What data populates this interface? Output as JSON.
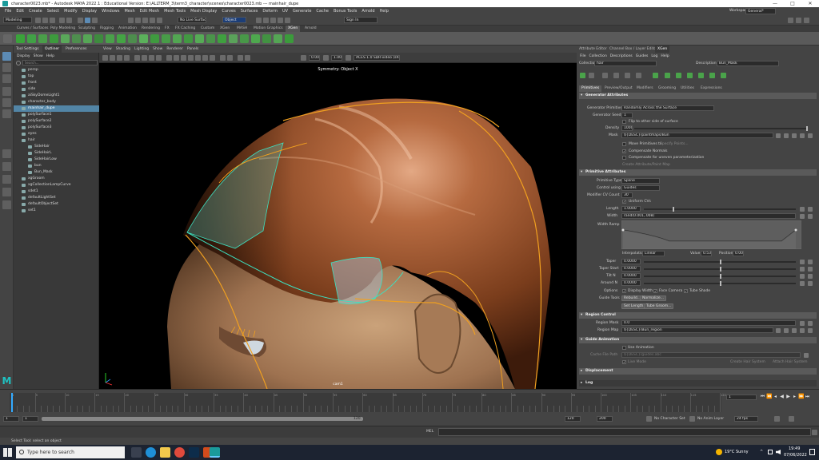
{
  "titlebar": {
    "title": "character0023.mb* - Autodesk MAYA 2022.1 : Educational Version: E:\\ALLTERM_3\\term3_character\\scenes\\character0023.mb  ---  mainhair_dupe",
    "controls": [
      "—",
      "□",
      "✕"
    ]
  },
  "menubar": {
    "items": [
      "File",
      "Edit",
      "Create",
      "Select",
      "Modify",
      "Display",
      "Windows",
      "Mesh",
      "Edit Mesh",
      "Mesh Tools",
      "Mesh Display",
      "Curves",
      "Surfaces",
      "Deform",
      "UV",
      "Generate",
      "Cache",
      "Bonus Tools",
      "Arnold",
      "Help"
    ],
    "workspace_label": "Workspace:",
    "workspace_value": "General*"
  },
  "statusline": {
    "mode": "Modeling",
    "object_field": "Object",
    "live_surface": "No Live Surface",
    "sign_in": "Sign In"
  },
  "shelf_tabs": [
    "Curves / Surfaces",
    "Poly Modeling",
    "Sculpting",
    "Rigging",
    "Animation",
    "Rendering",
    "FX",
    "FX Caching",
    "Custom",
    "XGen",
    "MASH",
    "Motion Graphics",
    "XGen",
    "Arnold"
  ],
  "shelf_active": 12,
  "outliner": {
    "tabs": [
      "Tool Settings",
      "Outliner",
      "Preferences"
    ],
    "menu": [
      "Display",
      "Show",
      "Help"
    ],
    "search_placeholder": "Search...",
    "rows": [
      {
        "label": "persp",
        "indent": 0,
        "sel": false
      },
      {
        "label": "top",
        "indent": 0,
        "sel": false
      },
      {
        "label": "front",
        "indent": 0,
        "sel": false
      },
      {
        "label": "side",
        "indent": 0,
        "sel": false
      },
      {
        "label": "aiSkyDomeLight1",
        "indent": 0,
        "sel": false
      },
      {
        "label": "character_body",
        "indent": 0,
        "sel": false
      },
      {
        "label": "mainhair_dupe",
        "indent": 0,
        "sel": true
      },
      {
        "label": "polySurface1",
        "indent": 0,
        "sel": false
      },
      {
        "label": "polySurface2",
        "indent": 0,
        "sel": false
      },
      {
        "label": "polySurface3",
        "indent": 0,
        "sel": false
      },
      {
        "label": "eyes",
        "indent": 0,
        "sel": false
      },
      {
        "label": "hair",
        "indent": 0,
        "sel": false
      },
      {
        "label": "SideHair",
        "indent": 1,
        "sel": false
      },
      {
        "label": "SideHairL",
        "indent": 1,
        "sel": false
      },
      {
        "label": "SideHairLow",
        "indent": 1,
        "sel": false
      },
      {
        "label": "bun",
        "indent": 1,
        "sel": false
      },
      {
        "label": "Bun_Mask",
        "indent": 1,
        "sel": false
      },
      {
        "label": "xgGroom",
        "indent": 0,
        "sel": false
      },
      {
        "label": "xgCollectionLampCurve",
        "indent": 0,
        "sel": false
      },
      {
        "label": "sdet1",
        "indent": 0,
        "sel": false
      },
      {
        "label": "defaultLightSet",
        "indent": 0,
        "sel": false
      },
      {
        "label": "defaultObjectSet",
        "indent": 0,
        "sel": false
      },
      {
        "label": "set1",
        "indent": 0,
        "sel": false
      }
    ]
  },
  "viewport": {
    "menu": [
      "View",
      "Shading",
      "Lighting",
      "Show",
      "Renderer",
      "Panels"
    ],
    "exposure": "0.00",
    "gamma": "1.00",
    "colorspace": "ACES 1.0 SDR-video (sRGB)",
    "title": "Symmetry: Object X",
    "camera": "cam1"
  },
  "right_panel": {
    "tabs": [
      "Attribute Editor",
      "Channel Box / Layer Editor",
      "XGen"
    ],
    "menu": [
      "File",
      "Collection",
      "Descriptions",
      "Guides",
      "Log",
      "Help"
    ],
    "collection_label": "Collection",
    "collection_value": "hair",
    "description_label": "Description",
    "description_value": "Bun_Mask",
    "sub_tabs": [
      "Primitives",
      "Preview/Output",
      "Modifiers",
      "Grooming",
      "Utilities",
      "Expressions"
    ],
    "generator": {
      "header": "Generator Attributes",
      "generate_label": "Generator Primitives",
      "generate_value": "Randomly Across the Surface",
      "seed_label": "Generator Seed",
      "seed_value": "1",
      "flip_label": "Flip to other side of surface",
      "density_label": "Density",
      "density_value": "1000",
      "mask_label": "Mask",
      "mask_value": "${DESC}/paintmaps/Bun",
      "move_label": "Move Primitives to",
      "specify_label": "Specify Points...",
      "comp_normals": "Compensate Normals",
      "comp_uneven": "Compensate for uneven parameterization",
      "create_paint": "Create Attribute/Paint Map"
    },
    "primitive": {
      "header": "Primitive Attributes",
      "type_label": "Primitive Type",
      "type_value": "Spline",
      "control_label": "Control using",
      "control_value": "Guides",
      "cv_label": "Modifier CV Count",
      "cv_value": "30",
      "uniform_label": "Uniform CVs",
      "length_label": "Length",
      "length_value": "1.0000",
      "width_label": "Width",
      "width_value": "rand(0.001,.008)",
      "ramp_label": "Width Ramp",
      "interp_label": "Interpolation",
      "interp_value": "Linear",
      "value_label": "Value",
      "value_value": "0.532",
      "pos_label": "Position",
      "pos_value": "0.000",
      "taper_label": "Taper",
      "taper_value": "0.0000",
      "taper_start_label": "Taper Start",
      "taper_start_value": "0.0000",
      "tilt_label": "Tilt N",
      "tilt_value": "0.0000",
      "around_label": "Around N",
      "around_value": "0.0000",
      "options_label": "Options",
      "display_width": "Display Width",
      "face_camera": "Face Camera",
      "tube_shade": "Tube Shade",
      "guide_tools": "Guide Tools",
      "rebuild": "Rebuild...",
      "normalize": "Normalize...",
      "set_length": "Set Length...",
      "tube_groom": "Tube Groom..."
    },
    "region": {
      "header": "Region Control",
      "mask_label": "Region Mask",
      "mask_value": "0.0",
      "map_label": "Region Map",
      "map_value": "${DESC}/Bun_region"
    },
    "guide_anim": {
      "header": "Guide Animation",
      "use_label": "Use Animation",
      "cache_label": "Cache File Path",
      "cache_value": "${DESC}/guides.abc",
      "live_mode": "Live Mode",
      "create_hair": "Create Hair System",
      "attach_hair": "Attach Hair System"
    },
    "displacement_header": "Displacement",
    "log_header": "Log"
  },
  "timeline": {
    "tick_labels": [
      "1",
      "5",
      "10",
      "15",
      "20",
      "25",
      "30",
      "35",
      "40",
      "45",
      "50",
      "55",
      "60",
      "65",
      "70",
      "75",
      "80",
      "85",
      "90",
      "95",
      "100",
      "105",
      "110",
      "115",
      "120"
    ],
    "current_frame": "1",
    "range_start": "1",
    "range_start2": "1",
    "range_end": "120",
    "range_end2": "120",
    "anim_end": "200",
    "char_set": "No Character Set",
    "anim_layer": "No Anim Layer",
    "fps": "24 fps"
  },
  "cmdline": {
    "lang": "MEL",
    "help": "Select Tool: select an object"
  },
  "taskbar": {
    "search_placeholder": "Type here to search",
    "weather": "19°C  Sunny",
    "time": "19:49",
    "date": "07/06/2022"
  }
}
